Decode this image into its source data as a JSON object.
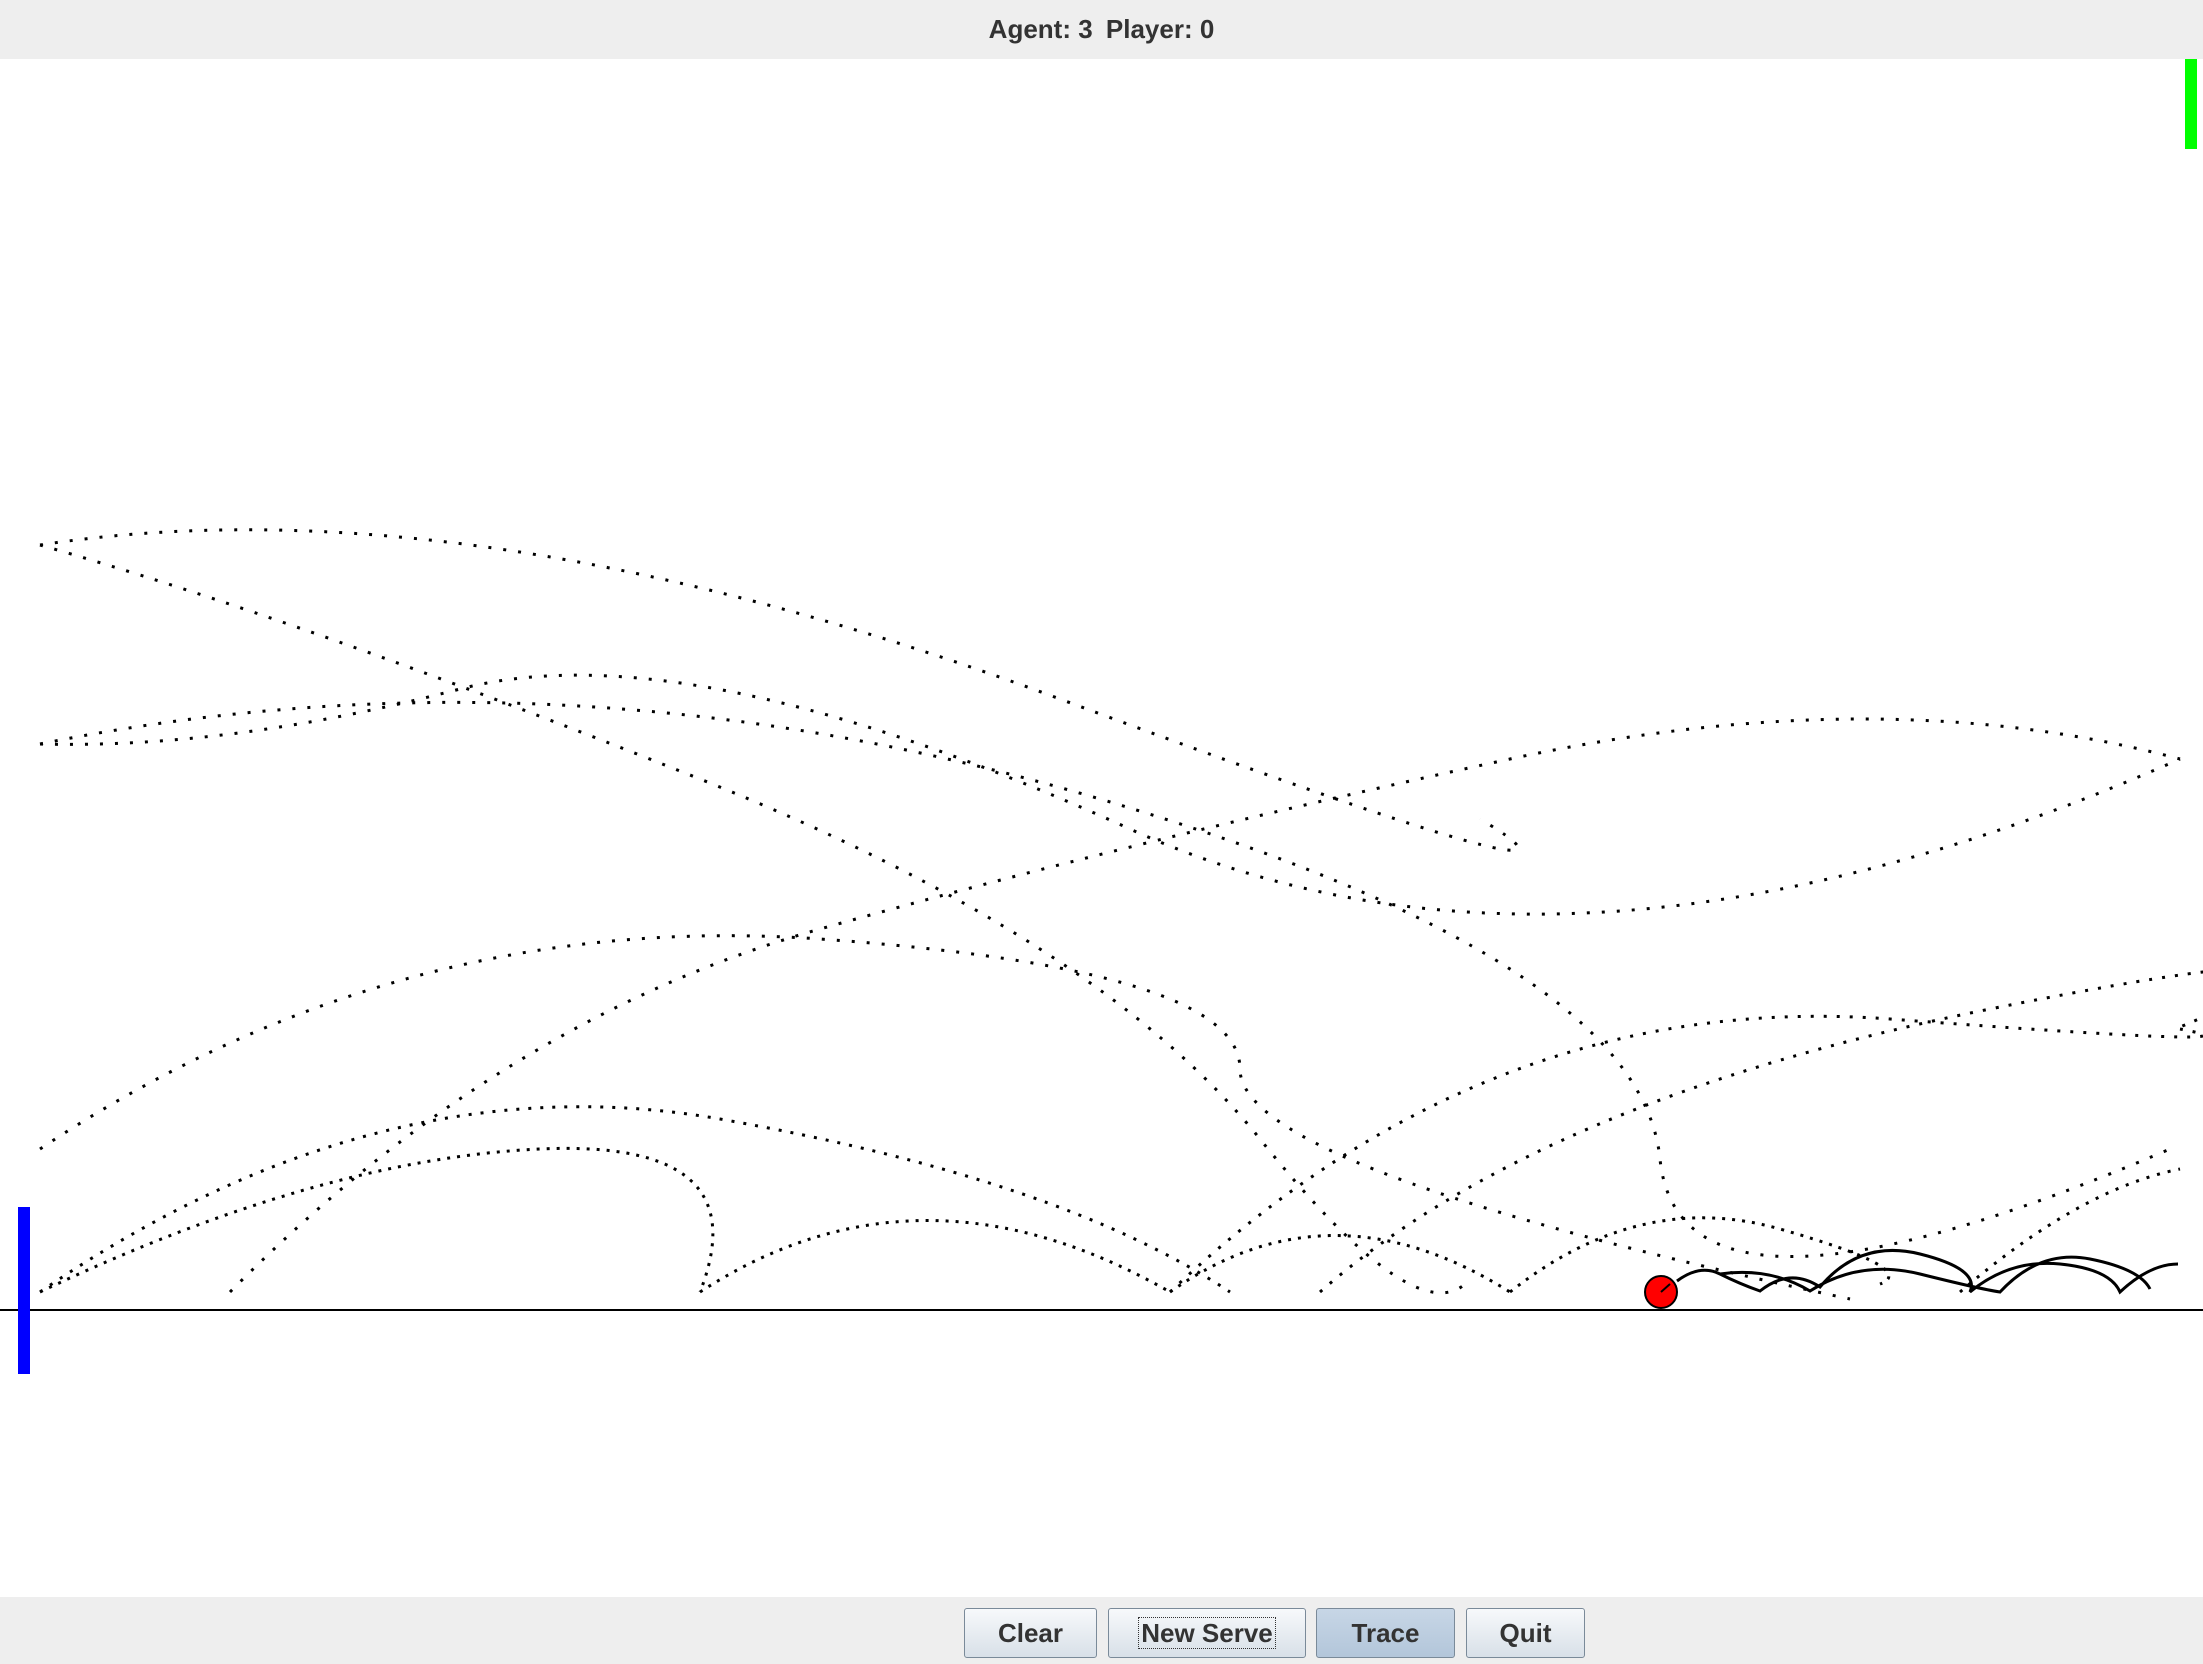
{
  "scoreboard": {
    "agent_text": "Agent: 3",
    "player_text": "Player: 0"
  },
  "colors": {
    "toolbar_bg": "#eeeeee",
    "court_bg": "#ffffff",
    "agent_paddle": "#0000ff",
    "player_paddle": "#00ff00",
    "ball": "#ff0000",
    "trace": "#000000"
  },
  "buttons": {
    "clear": "Clear",
    "new_serve": "New Serve",
    "trace": "Trace",
    "quit": "Quit"
  },
  "state": {
    "trace_enabled": true,
    "focused_button": "New Serve"
  }
}
